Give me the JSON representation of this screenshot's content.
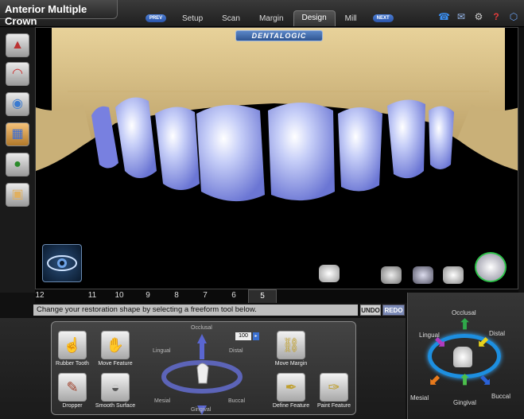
{
  "app": {
    "title": "Anterior Multiple Crown"
  },
  "nav": {
    "prev_label": "PREV",
    "next_label": "NEXT",
    "tabs": [
      {
        "label": "Setup",
        "active": false
      },
      {
        "label": "Scan",
        "active": false
      },
      {
        "label": "Margin",
        "active": false
      },
      {
        "label": "Design",
        "active": true
      },
      {
        "label": "Mill",
        "active": false
      }
    ]
  },
  "viewport": {
    "brand": "DENTALOGIC"
  },
  "teeth": {
    "numbers": [
      "12",
      "11",
      "10",
      "9",
      "8",
      "7",
      "6",
      "5"
    ],
    "active": "5"
  },
  "message": "Change your restoration shape by selecting a freeform tool below.",
  "history": {
    "undo_label": "UNDO",
    "redo_label": "REDO"
  },
  "freeform": {
    "tools": {
      "rubber_tooth": "Rubber Tooth",
      "move_feature": "Move Feature",
      "dropper": "Dropper",
      "smooth_surface": "Smooth Surface",
      "move_margin": "Move Margin",
      "define_feature": "Define Feature",
      "paint_feature": "Paint Feature"
    },
    "directions": {
      "occlusal": "Occlusal",
      "lingual": "Lingual",
      "distal": "Distal",
      "mesial": "Mesial",
      "buccal": "Buccal",
      "gingival": "Gingival"
    },
    "value": "100"
  },
  "orientation": {
    "occlusal": "Occlusal",
    "lingual": "Lingual",
    "distal": "Distal",
    "mesial": "Mesial",
    "buccal": "Buccal",
    "gingival": "Gingival",
    "colors": {
      "occlusal": "#2fa84a",
      "lingual": "#b03cc0",
      "distal": "#e8d21c",
      "mesial": "#e87a1c",
      "buccal": "#2a62d8",
      "gingival": "#4cc04c"
    }
  },
  "icons": [
    "phone-icon",
    "mail-icon",
    "settings-icon",
    "help-icon",
    "exit-icon"
  ]
}
